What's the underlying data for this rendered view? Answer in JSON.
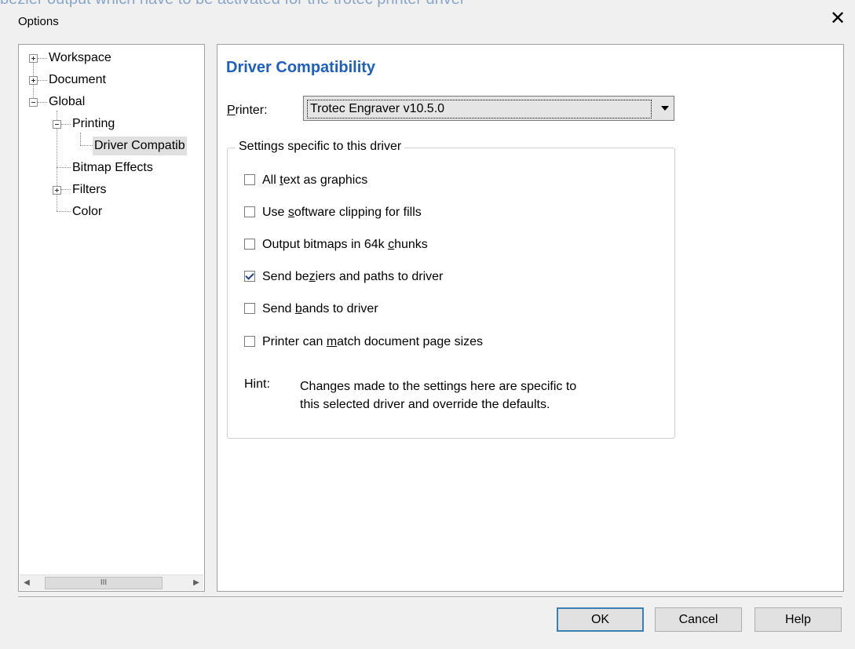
{
  "background_caption": "bezier output which have to be activated for the trotec printer driver",
  "window": {
    "title": "Options",
    "close_glyph": "✕"
  },
  "tree": {
    "items": [
      {
        "label": "Workspace",
        "expander": "plus"
      },
      {
        "label": "Document",
        "expander": "plus"
      },
      {
        "label": "Global",
        "expander": "minus"
      },
      {
        "label": "Printing",
        "expander": "minus"
      },
      {
        "label": "Driver Compatib",
        "selected": true
      },
      {
        "label": "Bitmap Effects"
      },
      {
        "label": "Filters",
        "expander": "plus"
      },
      {
        "label": "Color"
      }
    ],
    "scrollbar": {
      "left_arrow": "◀",
      "right_arrow": "▶",
      "thumb_grip": "III"
    }
  },
  "panel": {
    "heading": "Driver Compatibility",
    "heading_color": "#1f5fbf",
    "printer_label": "Printer:",
    "printer_label_mnemonic": "P",
    "printer_value": "Trotec Engraver v10.5.0",
    "group_title": "Settings specific to this driver",
    "options": [
      {
        "label": "All text as graphics",
        "checked": false
      },
      {
        "label": "Use software clipping for fills",
        "checked": false
      },
      {
        "label": "Output bitmaps in 64k chunks",
        "checked": false
      },
      {
        "label": "Send beziers and paths to driver",
        "checked": true
      },
      {
        "label": "Send bands to driver",
        "checked": false
      },
      {
        "label": "Printer can match document page sizes",
        "checked": false
      }
    ],
    "hint_label": "Hint:",
    "hint_text_line1": "Changes made to the settings here are specific to",
    "hint_text_line2": "this selected driver and override the defaults."
  },
  "buttons": {
    "ok": "OK",
    "cancel": "Cancel",
    "help": "Help"
  }
}
